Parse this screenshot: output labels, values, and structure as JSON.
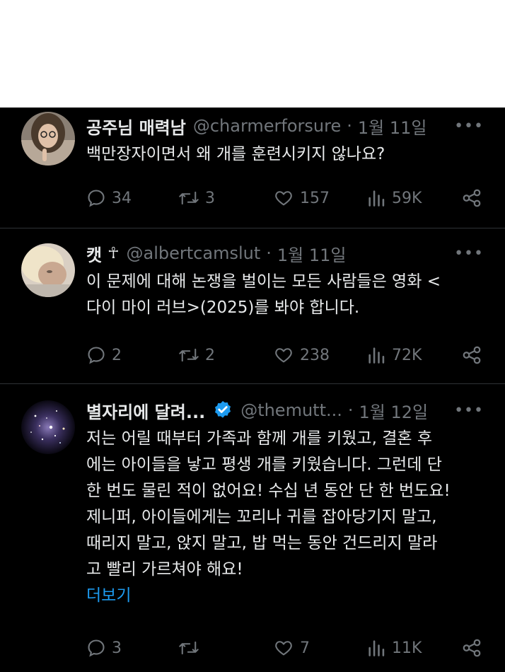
{
  "tweets": [
    {
      "display_name": "공주님 매력남",
      "handle": "@charmerforsure",
      "date": "1월 11일",
      "text": "백만장자이면서 왜 개를 훈련시키지 않나요?",
      "replies": "34",
      "retweets": "3",
      "likes": "157",
      "views": "59K"
    },
    {
      "display_name": "캣",
      "name_icon": "☥",
      "handle": "@albertcamslut",
      "date": "1월 11일",
      "text": "이 문제에 대해 논쟁을 벌이는 모든 사람들은 영화 <\n다이 마이 러브>(2025)를 봐야 합니다.",
      "replies": "2",
      "retweets": "2",
      "likes": "238",
      "views": "72K"
    },
    {
      "display_name": "별자리에 달려...",
      "handle": "@themutt...",
      "date": "1월 12일",
      "text": "저는 어릴 때부터 가족과 함께 개를 키웠고, 결혼 후\n에는 아이들을 낳고 평생 개를 키웠습니다. 그런데 단\n한 번도 물린 적이 없어요! 수십 년 동안 단 한 번도요!\n제니퍼, 아이들에게는 꼬리나 귀를 잡아당기지 말고,\n때리지 말고, 앉지 말고, 밥 먹는 동안 건드리지 말라\n고 빨리 가르쳐야 해요!",
      "show_more": "더보기",
      "replies": "3",
      "retweets": "",
      "likes": "7",
      "views": "11K"
    }
  ],
  "separator": "·",
  "more_glyph": "•••",
  "colors": {
    "background": "#000000",
    "text": "#e7e9ea",
    "muted": "#71767b",
    "link": "#1d9bf0",
    "verified": "#1d9bf0",
    "divider": "#2f3336"
  },
  "icons": [
    "reply-icon",
    "retweet-icon",
    "like-icon",
    "views-icon",
    "share-icon",
    "more-icon",
    "verified-badge-icon"
  ]
}
